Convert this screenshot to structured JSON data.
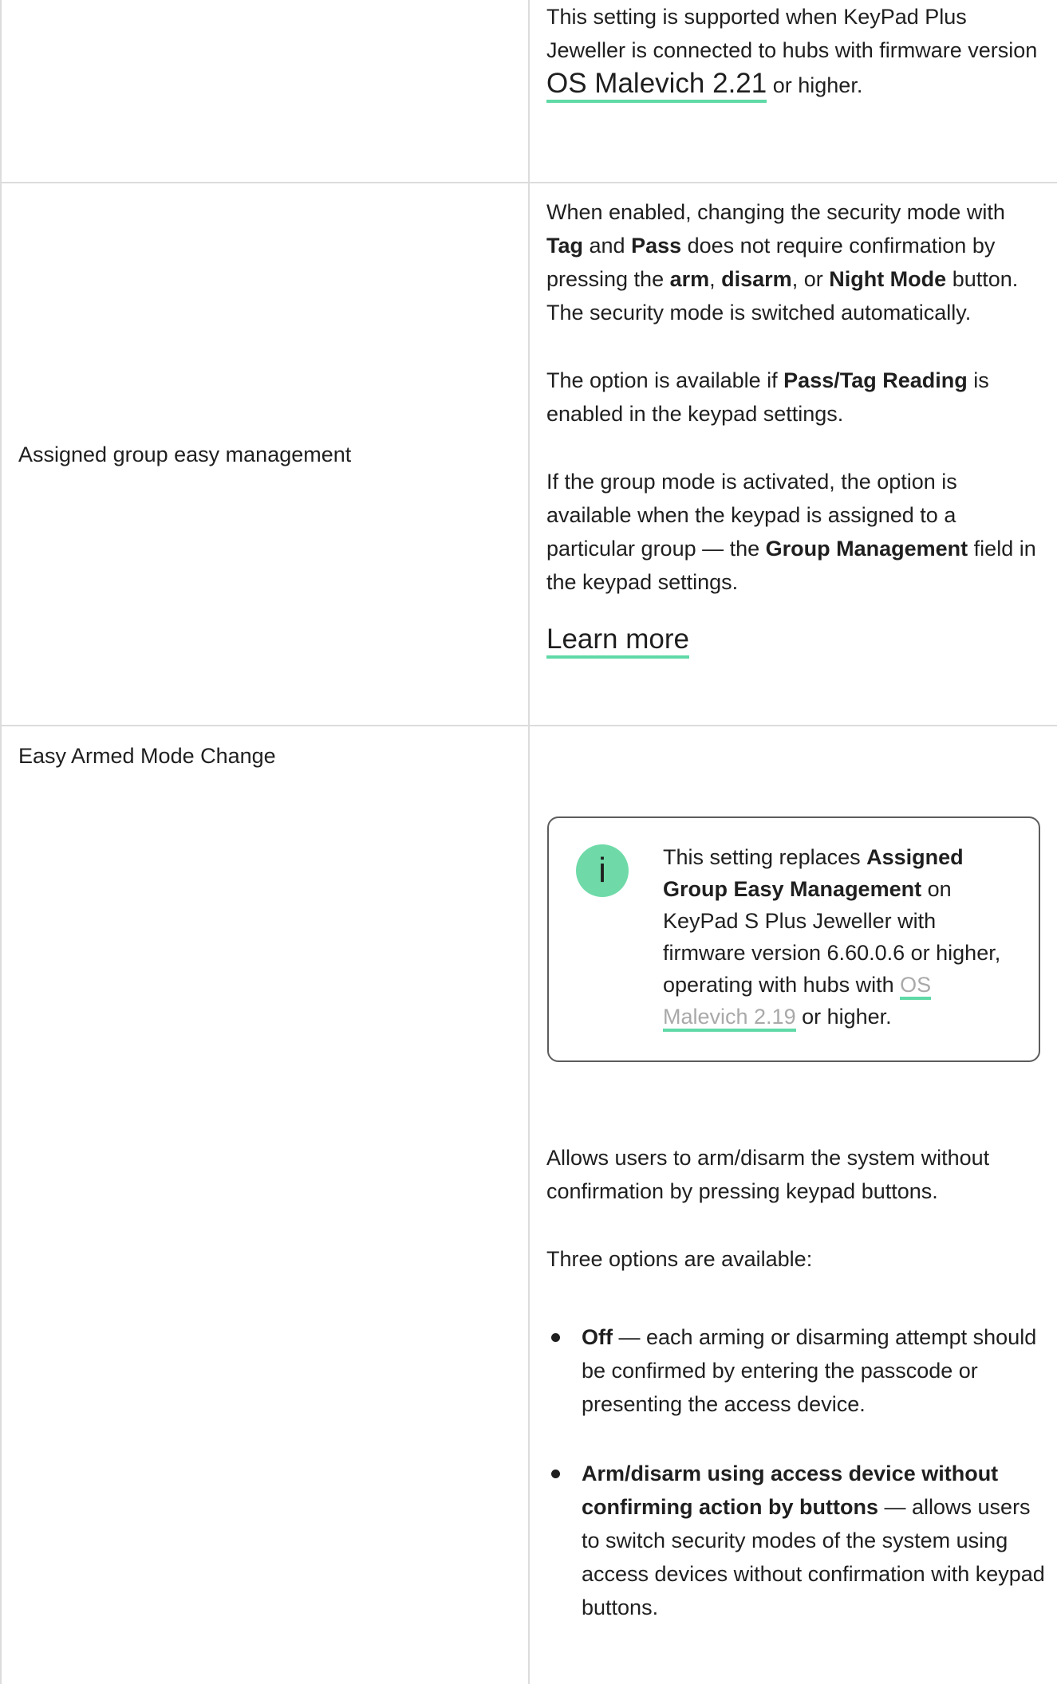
{
  "row1": {
    "desc_before": "This setting is supported when KeyPad Plus Jeweller is connected to hubs with firmware version ",
    "desc_link": "OS Malevich 2.21",
    "desc_after": " or higher."
  },
  "row2": {
    "label": "Assigned group easy management",
    "p1": {
      "t1": "When enabled, changing the security mode with ",
      "b1": "Tag",
      "t2": " and ",
      "b2": "Pass",
      "t3": " does not require confirmation by pressing the ",
      "b3": "arm",
      "t4": ", ",
      "b4": "disarm",
      "t5": ", or ",
      "b5": "Night Mode",
      "t6": " button. The security mode is switched automatically."
    },
    "p2": {
      "t1": "The option is available if ",
      "b1": "Pass/Tag Reading",
      "t2": " is enabled in the keypad settings."
    },
    "p3": {
      "t1": "If the group mode is activated, the option is available when the keypad is assigned to a particular group — the ",
      "b1": "Group Management",
      "t2": " field in the keypad settings."
    },
    "learn_more": "Learn more"
  },
  "row3": {
    "label": "Easy Armed Mode Change",
    "info": {
      "icon": "info-icon",
      "icon_glyph": "i",
      "t1": "This setting replaces ",
      "b1": "Assigned Group Easy Management",
      "t2": " on KeyPad S Plus Jeweller with firmware version 6.60.0.6 or higher, operating with hubs with ",
      "link": "OS Malevich 2.19",
      "t3": " or higher."
    },
    "p1": "Allows users to arm/disarm the system without confirmation by pressing keypad buttons.",
    "p2": "Three options are available:",
    "options": [
      {
        "bold": "Off",
        "text": " — each arming or disarming attempt should be confirmed by entering the passcode or presenting the access device."
      },
      {
        "bold": "Arm/disarm using access device without confirming action by buttons",
        "text": " — allows users to switch security modes of the system using access devices without confirmation with keypad buttons."
      }
    ]
  },
  "colors": {
    "accent": "#5fd9a6",
    "icon_bg": "#6fdaa8",
    "border": "#dcdcdc",
    "text": "#1f1f1f"
  }
}
